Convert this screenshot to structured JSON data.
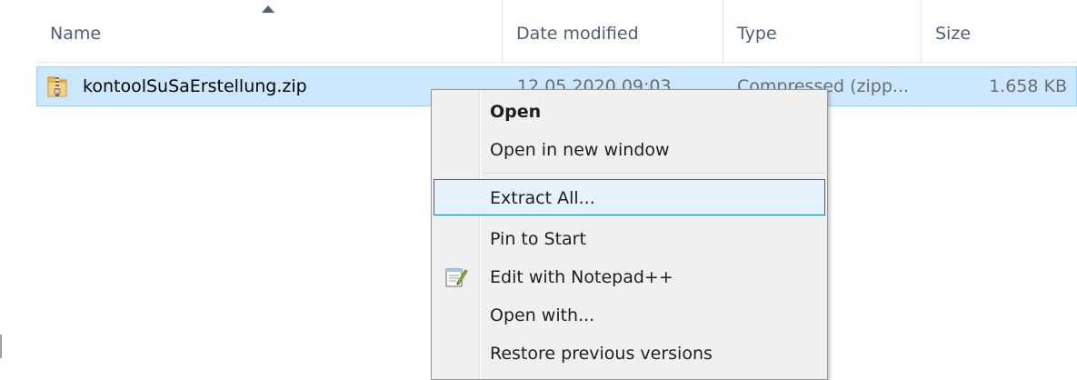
{
  "columns": {
    "name": "Name",
    "date_modified": "Date modified",
    "type": "Type",
    "size": "Size"
  },
  "file": {
    "name": "kontoolSuSaErstellung.zip",
    "date_modified": "12.05.2020 09:03",
    "type": "Compressed (zipp...",
    "size": "1.658 KB",
    "icon": "zip-folder-icon"
  },
  "context_menu": {
    "items": [
      {
        "label": "Open",
        "bold": true
      },
      {
        "label": "Open in new window"
      },
      {
        "label": "Extract All...",
        "highlighted": true
      },
      {
        "label": "Pin to Start"
      },
      {
        "label": "Edit with Notepad++",
        "icon": "notepad-plus-plus-icon"
      },
      {
        "label": "Open with..."
      },
      {
        "label": "Restore previous versions"
      }
    ]
  },
  "colors": {
    "selection_bg": "#cce8ff",
    "selection_border": "#99d1ff",
    "menu_bg": "#f0f0f0",
    "menu_highlight_border": "#0078d7",
    "header_text": "#4c607a"
  }
}
